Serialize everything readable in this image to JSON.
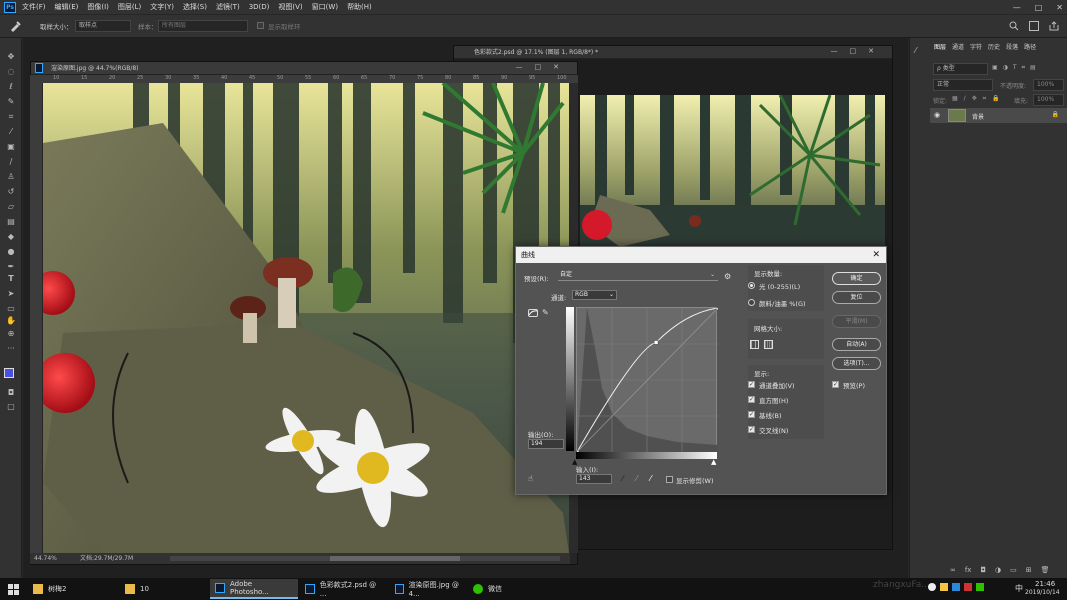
{
  "app": {
    "logo": "Ps"
  },
  "menu": [
    "文件(F)",
    "编辑(E)",
    "图像(I)",
    "图层(L)",
    "文字(Y)",
    "选择(S)",
    "滤镜(T)",
    "3D(D)",
    "视图(V)",
    "窗口(W)",
    "帮助(H)"
  ],
  "window_buttons": [
    "—",
    "□",
    "✕"
  ],
  "options": {
    "sample_size_label": "取样大小：",
    "sample_size_value": "取样点",
    "sample_label": "样本：",
    "sample_value": "所有图层",
    "show_ring_label": "显示取样环"
  },
  "tools": [
    "move-tool",
    "marquee-tool",
    "lasso-tool",
    "quick-select-tool",
    "crop-tool",
    "eyedropper-tool",
    "healing-tool",
    "brush-tool",
    "stamp-tool",
    "history-brush-tool",
    "eraser-tool",
    "gradient-tool",
    "blur-tool",
    "dodge-tool",
    "pen-tool",
    "type-tool",
    "path-select-tool",
    "shape-tool",
    "hand-tool",
    "zoom-tool",
    "more-tool"
  ],
  "doc1": {
    "title": "渲染原图.jpg @ 44.7%(RGB/8)",
    "ruler_ticks": [
      "10",
      "15",
      "20",
      "25",
      "30",
      "35",
      "40",
      "45",
      "50",
      "55",
      "60",
      "65",
      "70",
      "75",
      "80",
      "85",
      "90",
      "95",
      "100"
    ],
    "zoom": "44.74%",
    "doc_info": "文档:29.7M/29.7M"
  },
  "doc2": {
    "title": "色彩款式2.psd @ 17.1% (图层 1, RGB/8*) *"
  },
  "panel": {
    "tabs": [
      "图层",
      "通道",
      "字符",
      "历史",
      "段落",
      "路径"
    ],
    "kind_label": "ρ 类型",
    "blend_mode": "正常",
    "opacity_label": "不透明度:",
    "opacity_value": "100%",
    "lock_label": "锁定:",
    "fill_label": "填充:",
    "fill_value": "100%",
    "layer_name": "背景"
  },
  "curves": {
    "title": "曲线",
    "preset_label": "预设(R):",
    "preset_value": "自定",
    "channel_label": "通道:",
    "channel_value": "RGB",
    "output_label": "输出(O):",
    "output_value": "194",
    "input_label": "输入(I):",
    "input_value": "143",
    "show_clipping_label": "显示修剪(W)",
    "display_amount_label": "显示数量:",
    "light_label": "光 (0-255)(L)",
    "pigment_label": "颜料/油墨 %(G)",
    "grid_size_label": "网格大小:",
    "show_label": "显示:",
    "show_options": [
      "通道叠加(V)",
      "直方图(H)",
      "基线(B)",
      "交叉线(N)"
    ],
    "buttons": {
      "ok": "确定",
      "reset": "复位",
      "smooth": "平滑(M)",
      "auto": "自动(A)",
      "options": "选项(T)..."
    },
    "preview_label": "预览(P)",
    "curve_points": [
      [
        0,
        0
      ],
      [
        143,
        194
      ],
      [
        255,
        255
      ]
    ]
  },
  "taskbar": {
    "items": [
      "树梅2",
      "10",
      "Adobe Photosho...",
      "色彩款式2.psd @ ...",
      "渲染原图.jpg @ 4...",
      "微信"
    ],
    "watermark": "zhangxuFa...",
    "time": "21:46",
    "date": "2019/10/14",
    "ime": "中"
  },
  "colors": {
    "accent": "#31a8ff",
    "panel": "#323232",
    "dialog": "#535353"
  }
}
